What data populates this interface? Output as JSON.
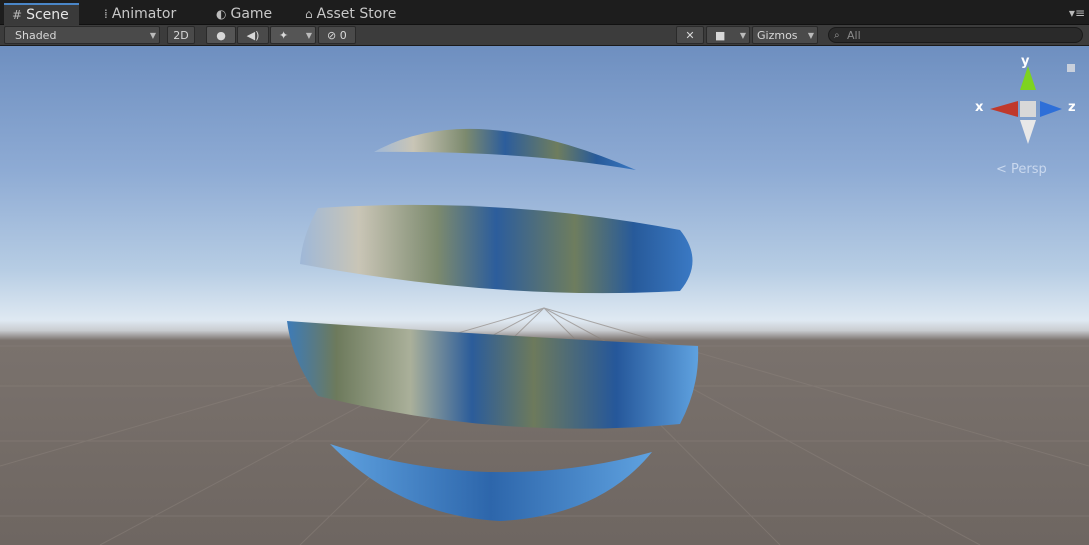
{
  "tabs": [
    {
      "label": "Scene",
      "icon": "grid-icon"
    },
    {
      "label": "Animator",
      "icon": "animator-icon"
    },
    {
      "label": "Game",
      "icon": "pacman-icon"
    },
    {
      "label": "Asset Store",
      "icon": "store-icon"
    }
  ],
  "toolbar": {
    "shading_mode": "Shaded",
    "two_d_label": "2D",
    "effects_count": "0",
    "gizmos_label": "Gizmos",
    "search_placeholder": "All"
  },
  "gizmo": {
    "x": "x",
    "y": "y",
    "z": "z",
    "projection": "Persp"
  },
  "colors": {
    "x_axis": "#c0392b",
    "y_axis": "#7ed321",
    "z_axis": "#2e6fd8",
    "accent": "#4a86c8"
  }
}
